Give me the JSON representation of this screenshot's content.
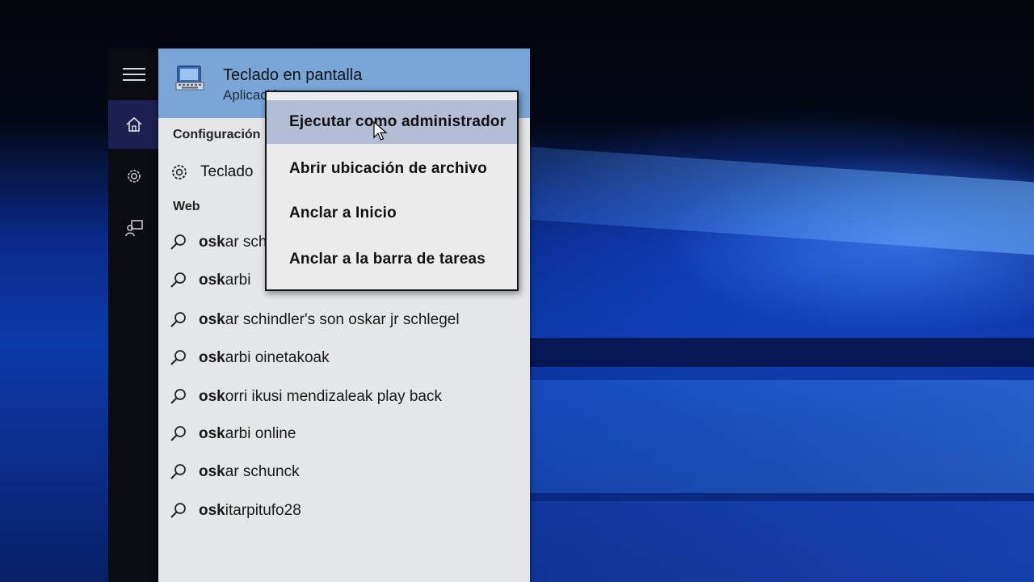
{
  "best_match": {
    "title": "Teclado en pantalla",
    "subtitle": "Aplicación",
    "icon": "on-screen-keyboard-icon"
  },
  "sections": {
    "settings_label": "Configuración",
    "web_label": "Web"
  },
  "settings_item": {
    "label": "Teclado",
    "icon": "gear-icon"
  },
  "web_results": [
    {
      "bold": "osk",
      "rest": "ar schindler"
    },
    {
      "bold": "osk",
      "rest": "arbi"
    },
    {
      "bold": "osk",
      "rest": "ar schindler's son oskar jr schlegel"
    },
    {
      "bold": "osk",
      "rest": "arbi oinetakoak"
    },
    {
      "bold": "osk",
      "rest": "orri ikusi mendizaleak play back"
    },
    {
      "bold": "osk",
      "rest": "arbi online"
    },
    {
      "bold": "osk",
      "rest": "ar schunck"
    },
    {
      "bold": "osk",
      "rest": "itarpitufo28"
    }
  ],
  "context_menu": {
    "items": [
      "Ejecutar como administrador",
      "Abrir ubicación de archivo",
      "Anclar a Inicio",
      "Anclar a la barra de tareas"
    ],
    "highlighted_index": 0
  },
  "rail": {
    "icons": [
      "hamburger-menu-icon",
      "home-icon",
      "gear-icon",
      "feedback-icon"
    ]
  },
  "colors": {
    "best_match_bg": "#79a6d7",
    "menu_hover_bg": "#b4bdd6",
    "rail_active_bg": "#1b1f52"
  }
}
